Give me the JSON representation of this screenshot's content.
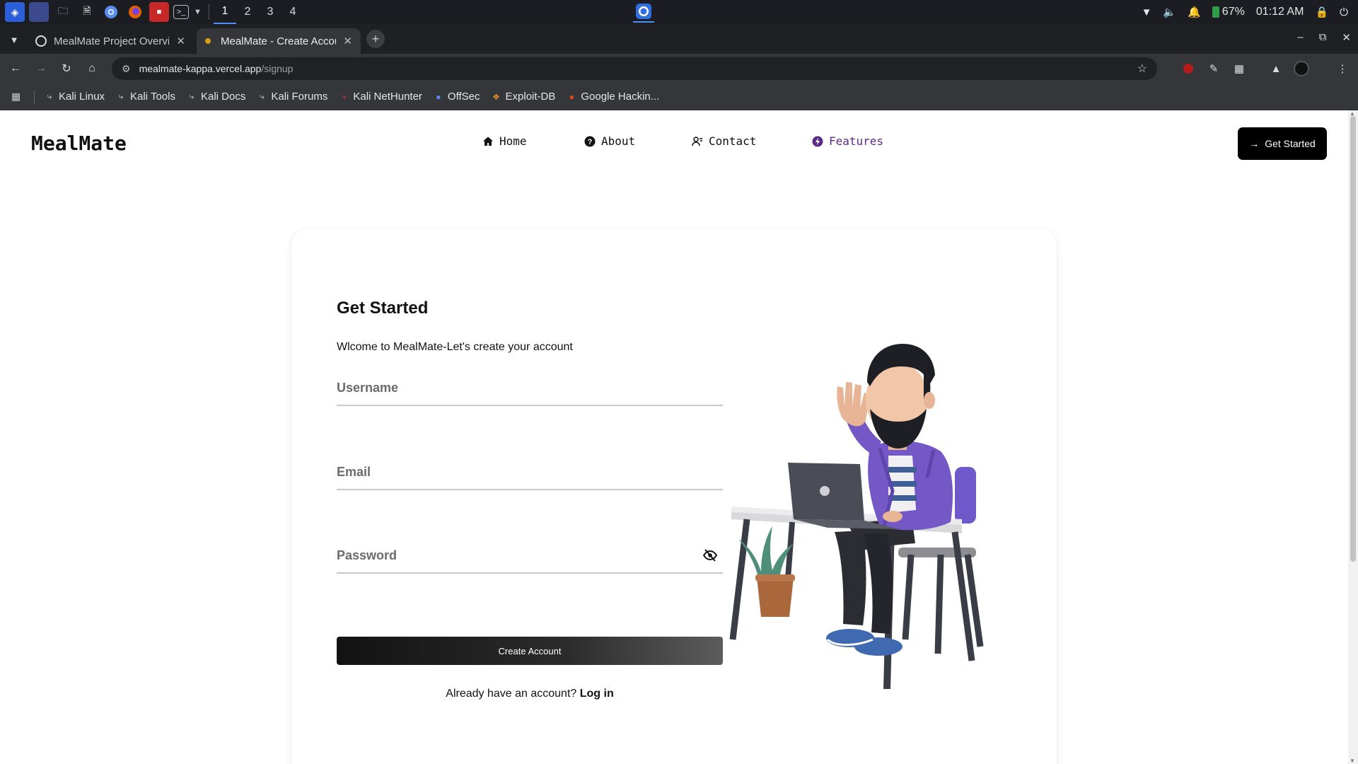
{
  "os": {
    "workspaces": [
      "1",
      "2",
      "3",
      "4"
    ],
    "active_workspace": "1",
    "battery": "67%",
    "clock": "01:12 AM"
  },
  "browser": {
    "tabs": [
      {
        "title": "MealMate Project Overvi",
        "icon": "github-icon"
      },
      {
        "title": "MealMate - Create Accou",
        "icon": "site-icon",
        "active": true
      }
    ],
    "url": {
      "host": "mealmate-kappa.vercel.app",
      "path": "/signup"
    },
    "bookmarks": [
      {
        "label": "Kali Linux",
        "icon": "kali-icon"
      },
      {
        "label": "Kali Tools",
        "icon": "kali-icon"
      },
      {
        "label": "Kali Docs",
        "icon": "kali-icon"
      },
      {
        "label": "Kali Forums",
        "icon": "kali-icon"
      },
      {
        "label": "Kali NetHunter",
        "icon": "nethunter-icon"
      },
      {
        "label": "OffSec",
        "icon": "offsec-icon"
      },
      {
        "label": "Exploit-DB",
        "icon": "exploitdb-icon"
      },
      {
        "label": "Google Hackin...",
        "icon": "ghdb-icon"
      }
    ]
  },
  "site": {
    "brand": "MealMate",
    "nav": [
      {
        "label": "Home",
        "icon": "home-icon"
      },
      {
        "label": "About",
        "icon": "question-icon"
      },
      {
        "label": "Contact",
        "icon": "contact-icon"
      },
      {
        "label": "Features",
        "icon": "features-icon"
      }
    ],
    "cta": "Get Started",
    "accent": "#5b2a86"
  },
  "form": {
    "title": "Get Started",
    "subtitle": "Wlcome to MealMate-Let's create your account",
    "username_placeholder": "Username",
    "email_placeholder": "Email",
    "password_placeholder": "Password",
    "submit": "Create Account",
    "login_prompt": "Already have an account?",
    "login_link": "Log in"
  }
}
